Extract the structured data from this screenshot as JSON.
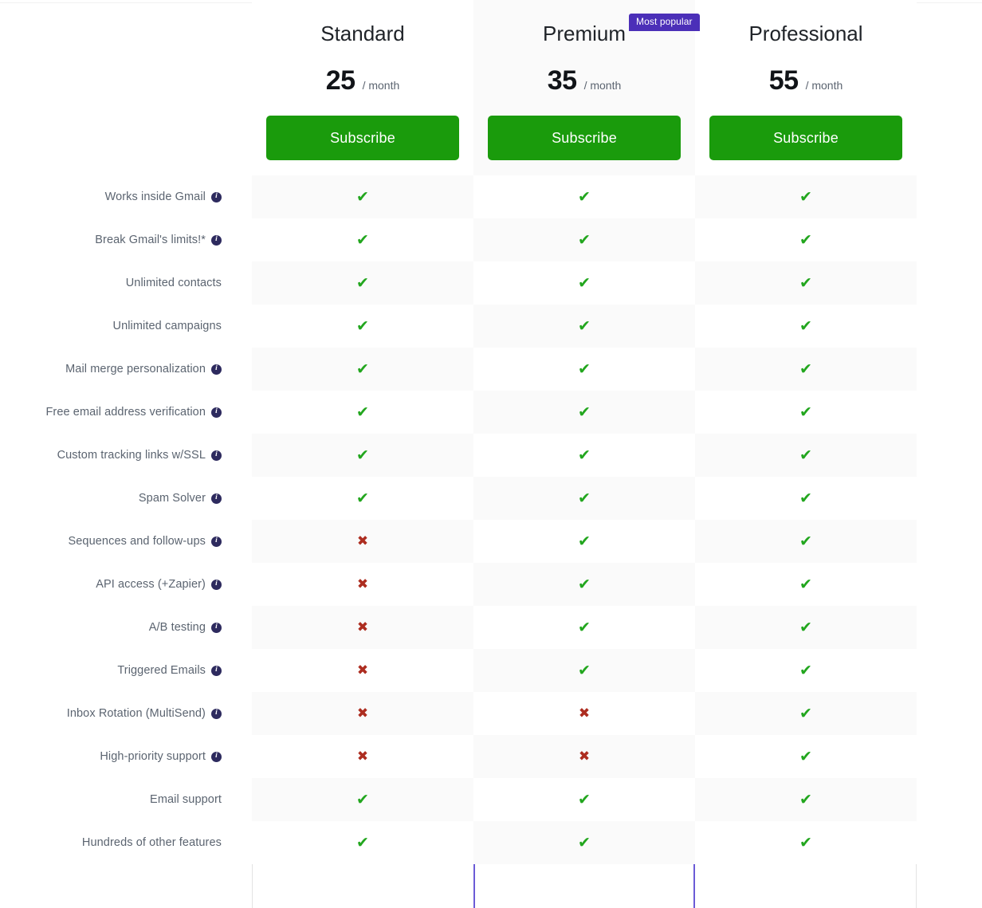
{
  "badge": {
    "label": "Most popular"
  },
  "colors": {
    "accent_purple": "#4b2fb8",
    "featured_border": "#6b5bd6",
    "subscribe_green": "#1a9b0c",
    "check_green": "#22a61e",
    "cross_red": "#ad2d20",
    "label_text": "#5b6470",
    "row_alt": "#fafafa"
  },
  "plans": [
    {
      "name": "Standard",
      "price": "25",
      "period": "/ month",
      "cta": "Subscribe",
      "featured": false
    },
    {
      "name": "Premium",
      "price": "35",
      "period": "/ month",
      "cta": "Subscribe",
      "featured": true
    },
    {
      "name": "Professional",
      "price": "55",
      "period": "/ month",
      "cta": "Subscribe",
      "featured": false
    }
  ],
  "icons": {
    "info": "i",
    "check": "✔",
    "cross": "✖"
  },
  "features": [
    {
      "label": "Works inside Gmail",
      "info": true,
      "standard": "check",
      "premium": "check",
      "professional": "check"
    },
    {
      "label": "Break Gmail's limits!*",
      "info": true,
      "standard": "check",
      "premium": "check",
      "professional": "check"
    },
    {
      "label": "Unlimited contacts",
      "info": false,
      "standard": "check",
      "premium": "check",
      "professional": "check"
    },
    {
      "label": "Unlimited campaigns",
      "info": false,
      "standard": "check",
      "premium": "check",
      "professional": "check"
    },
    {
      "label": "Mail merge personalization",
      "info": true,
      "standard": "check",
      "premium": "check",
      "professional": "check"
    },
    {
      "label": "Free email address verification",
      "info": true,
      "standard": "check",
      "premium": "check",
      "professional": "check"
    },
    {
      "label": "Custom tracking links w/SSL",
      "info": true,
      "standard": "check",
      "premium": "check",
      "professional": "check"
    },
    {
      "label": "Spam Solver",
      "info": true,
      "standard": "check",
      "premium": "check",
      "professional": "check"
    },
    {
      "label": "Sequences and follow-ups",
      "info": true,
      "standard": "cross",
      "premium": "check",
      "professional": "check"
    },
    {
      "label": "API access (+Zapier)",
      "info": true,
      "standard": "cross",
      "premium": "check",
      "professional": "check"
    },
    {
      "label": "A/B testing",
      "info": true,
      "standard": "cross",
      "premium": "check",
      "professional": "check"
    },
    {
      "label": "Triggered Emails",
      "info": true,
      "standard": "cross",
      "premium": "check",
      "professional": "check"
    },
    {
      "label": "Inbox Rotation (MultiSend)",
      "info": true,
      "standard": "cross",
      "premium": "cross",
      "professional": "check"
    },
    {
      "label": "High-priority support",
      "info": true,
      "standard": "cross",
      "premium": "cross",
      "professional": "check"
    },
    {
      "label": "Email support",
      "info": false,
      "standard": "check",
      "premium": "check",
      "professional": "check"
    },
    {
      "label": "Hundreds of other features",
      "info": false,
      "standard": "check",
      "premium": "check",
      "professional": "check"
    }
  ]
}
